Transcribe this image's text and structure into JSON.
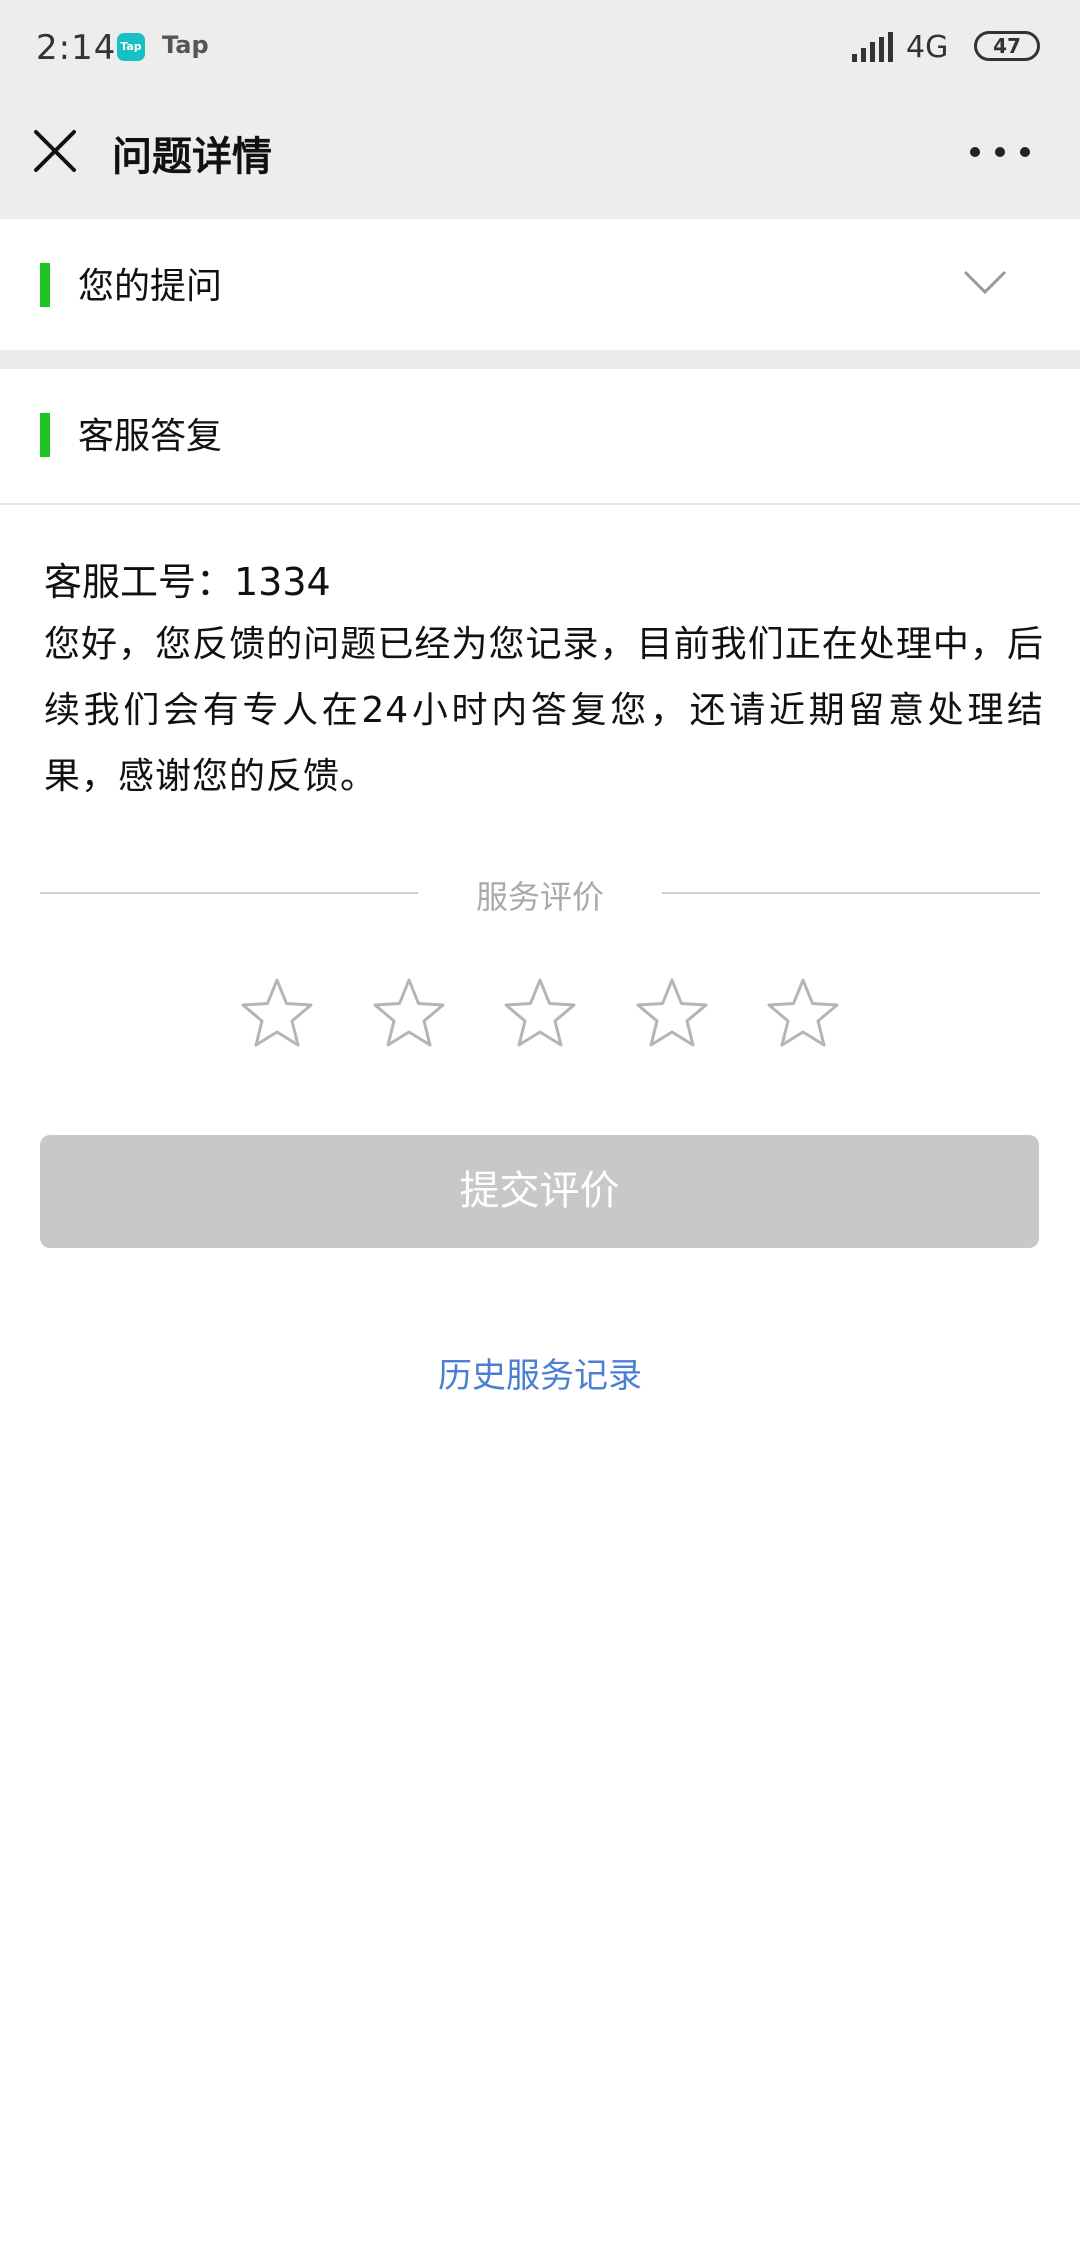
{
  "status_bar": {
    "time": "2:14",
    "app_badge": "Tap",
    "app_name": "Tap",
    "network": "4G",
    "battery": "47"
  },
  "header": {
    "title": "问题详情"
  },
  "sections": {
    "question_label": "您的提问",
    "reply_label": "客服答复"
  },
  "reply": {
    "staff_id": "客服工号：1334",
    "message": "您好，您反馈的问题已经为您记录，目前我们正在处理中，后续我们会有专人在24小时内答复您，还请近期留意处理结果，感谢您的反馈。"
  },
  "rating": {
    "title": "服务评价",
    "max_stars": 5,
    "selected_stars": 0
  },
  "submit_label": "提交评价",
  "history_link": "历史服务记录",
  "colors": {
    "accent_green": "#1ec51e",
    "link_blue": "#4a7fd4",
    "disabled_button": "#c8c8c8",
    "header_bg": "#ededed"
  }
}
